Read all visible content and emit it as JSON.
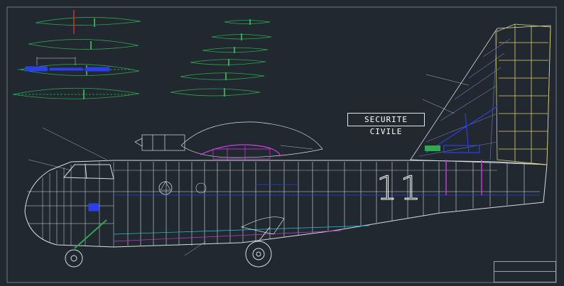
{
  "drawing": {
    "badge_text": "SECURITE CIVILE",
    "fuselage_number": "11",
    "colors": {
      "background": "#212830",
      "frame_lines": "#d8dde3",
      "airfoil_sections": "#2fa84f",
      "tail_ribs": "#d8d36a",
      "wing_details": "#c23bd0",
      "systems": "#2a3fe8",
      "rudder_spars": "#6f7ab8",
      "annotation_text": "#b23ab8"
    },
    "icons": [
      "fuselage-outline",
      "wing-root-profile",
      "tail-fin",
      "landing-gear",
      "engine-nacelle",
      "airfoil-section"
    ]
  },
  "title_block": {
    "row1": "",
    "row2": ""
  }
}
